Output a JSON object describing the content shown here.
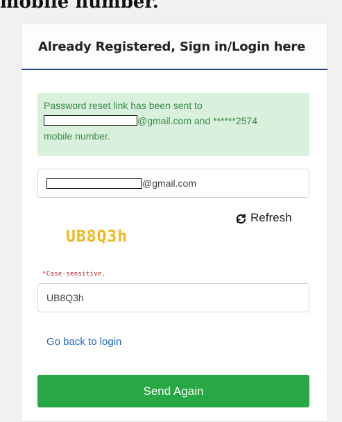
{
  "caption": {
    "text": "mobile number."
  },
  "header": {
    "title": "Already Registered, Sign in/Login here"
  },
  "alert": {
    "line1": "Password reset link has been sent to",
    "line2_suffix": "@gmail.com and ******2574",
    "line3": "mobile number."
  },
  "email_field": {
    "value_suffix": "@gmail.com"
  },
  "refresh": {
    "label": "Refresh",
    "icon": "refresh-icon"
  },
  "captcha": {
    "text": "UB8Q3h",
    "note": "*Case-sensitive."
  },
  "captcha_field": {
    "value": "UB8Q3h"
  },
  "back_link": {
    "label": "Go back to login"
  },
  "send_button": {
    "label": "Send Again"
  },
  "colors": {
    "header_rule": "#1f3f86",
    "alert_bg": "#d8f0dc",
    "alert_text": "#3b8a4b",
    "captcha": "#f0b81e",
    "note": "#b51a1a",
    "link": "#2067c4",
    "button": "#28a745"
  }
}
